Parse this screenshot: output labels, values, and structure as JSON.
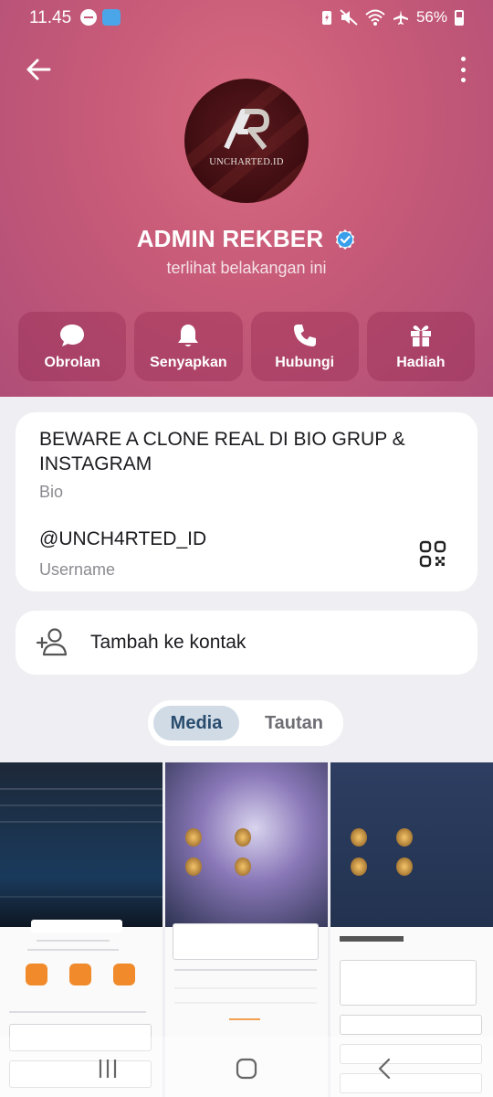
{
  "status_bar": {
    "time": "11.45",
    "battery": "56%",
    "icons": [
      "dnd-icon",
      "app-notification-icon",
      "battery-saver-icon",
      "mute-icon",
      "wifi-icon",
      "airplane-icon",
      "battery-icon"
    ]
  },
  "profile": {
    "name": "ADMIN REKBER",
    "verified": true,
    "last_seen": "terlihat belakangan ini",
    "avatar_text": "UNCHARTED.ID"
  },
  "actions": [
    {
      "label": "Obrolan",
      "icon": "chat-bubble-icon"
    },
    {
      "label": "Senyapkan",
      "icon": "bell-icon"
    },
    {
      "label": "Hubungi",
      "icon": "phone-icon"
    },
    {
      "label": "Hadiah",
      "icon": "gift-icon"
    }
  ],
  "info": {
    "bio": "BEWARE A CLONE REAL DI BIO GRUP & INSTAGRAM",
    "bio_label": "Bio",
    "username": "@UNCH4RTED_ID",
    "username_label": "Username"
  },
  "add_contact": {
    "label": "Tambah ke kontak"
  },
  "tabs": {
    "media": "Media",
    "links": "Tautan",
    "active": "Media"
  },
  "colors": {
    "header": "#c65a78",
    "tab_active_bg": "#d0dbe6",
    "tab_active_text": "#2a4d6e",
    "verified": "#3a9fea"
  }
}
